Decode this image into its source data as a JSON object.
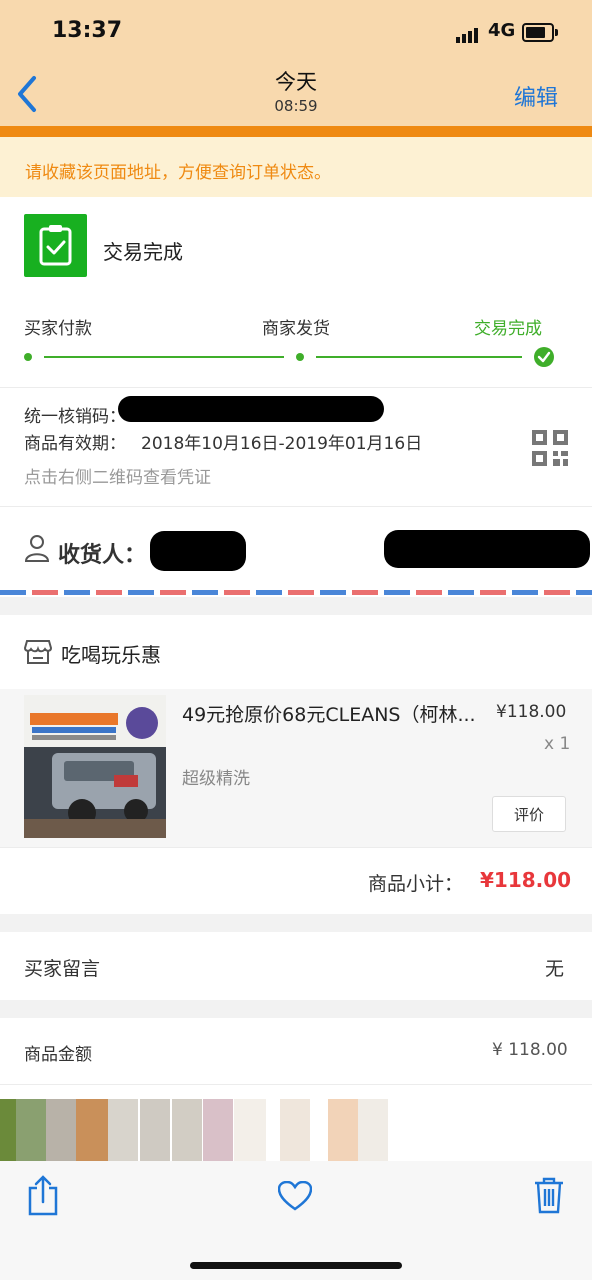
{
  "status_bar": {
    "time": "13:37",
    "network": "4G"
  },
  "nav": {
    "title": "今天",
    "subtitle": "08:59",
    "edit_label": "编辑"
  },
  "notice": {
    "text": "请收藏该页面地址，方便查询订单状态。"
  },
  "order_status": {
    "text": "交易完成",
    "steps": [
      "买家付款",
      "商家发货",
      "交易完成"
    ],
    "active_color": "#3fae2a"
  },
  "voucher": {
    "code_label": "统一核销码：",
    "validity_label": "商品有效期：",
    "validity_value": "2018年10月16日-2019年01月16日",
    "hint": "点击右侧二维码查看凭证"
  },
  "receiver": {
    "label": "收货人："
  },
  "shop": {
    "name": "吃喝玩乐惠"
  },
  "item": {
    "title": "49元抢原价68元CLEANS（柯林...",
    "spec": "超级精洗",
    "price": "¥118.00",
    "qty": "x 1",
    "review_label": "评价"
  },
  "subtotal": {
    "label": "商品小计：",
    "value": "¥118.00"
  },
  "buyer_message": {
    "label": "买家留言",
    "value": "无"
  },
  "goods_amount": {
    "label": "商品金额",
    "value": "¥ 118.00"
  },
  "colors": {
    "accent_orange": "#ef8a12",
    "brand_green": "#18b020",
    "price_red": "#e8373b",
    "link_blue": "#1f76d6"
  }
}
